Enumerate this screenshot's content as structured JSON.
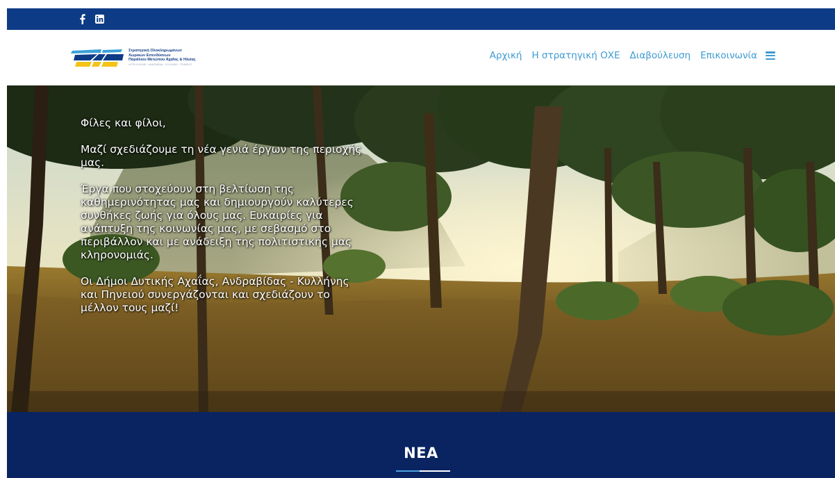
{
  "topbar": {
    "social": [
      {
        "icon": "facebook-icon",
        "glyph": "f"
      },
      {
        "icon": "linkedin-icon",
        "glyph": "in"
      }
    ]
  },
  "header": {
    "logo": {
      "lines": [
        "Στρατηγική Ολοκληρωμένων",
        "Χωρικών Επενδύσεων",
        "Παράλιου Μετώπου Αχαΐας & Ηλείας"
      ],
      "subline": "ΔΥΤΙΚΗ ΑΧΑΪΑ · ΑΝΔΡΑΒΙΔΑ - ΚΥΛΛΗΝΗ · ΠΗΝΕΙΟΣ"
    },
    "nav": [
      {
        "label": "Αρχική"
      },
      {
        "label": "Η στρατηγική ΟΧΕ"
      },
      {
        "label": "Διαβούλευση"
      },
      {
        "label": "Επικοινωνία"
      }
    ],
    "menu_icon": "hamburger-menu-icon"
  },
  "hero": {
    "paragraphs": [
      "Φίλες και φίλοι,",
      "Μαζί σχεδιάζουμε τη νέα γενιά έργων της περιοχής μας.",
      "Έργα που στοχεύουν στη βελτίωση της καθημερινότητας μας και δημιουργούν καλύτερες συνθήκες ζωής για όλους μας. Ευκαιρίες για ανάπτυξη της κοινωνίας μας, με σεβασμό στο περιβάλλον και με ανάδειξη της πολιτιστικής μας κληρονομιάς.",
      "Οι Δήμοι Δυτικής Αχαΐας, Ανδραβίδας - Κυλλήνης και Πηνειού συνεργάζονται και σχεδιάζουν το μέλλον τους μαζί!"
    ]
  },
  "news": {
    "title": "ΝΕΑ"
  },
  "colors": {
    "topbar": "#0d3b86",
    "nav_link": "#3d9ad1",
    "news_bg": "#0a2462",
    "accent": "#4ea1e0"
  }
}
